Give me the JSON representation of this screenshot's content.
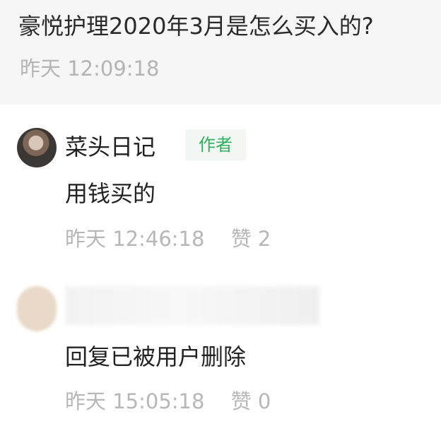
{
  "question": {
    "text": "豪悦护理2020年3月是怎么买入的?",
    "time": "昨天 12:09:18"
  },
  "replies": [
    {
      "author": "菜头日记",
      "badge": "作者",
      "text": "用钱买的",
      "time": "昨天 12:46:18",
      "like_label": "赞",
      "like_count": "2"
    },
    {
      "author": "",
      "badge": "",
      "text": "回复已被用户删除",
      "time": "昨天 15:05:18",
      "like_label": "赞",
      "like_count": "0"
    }
  ]
}
